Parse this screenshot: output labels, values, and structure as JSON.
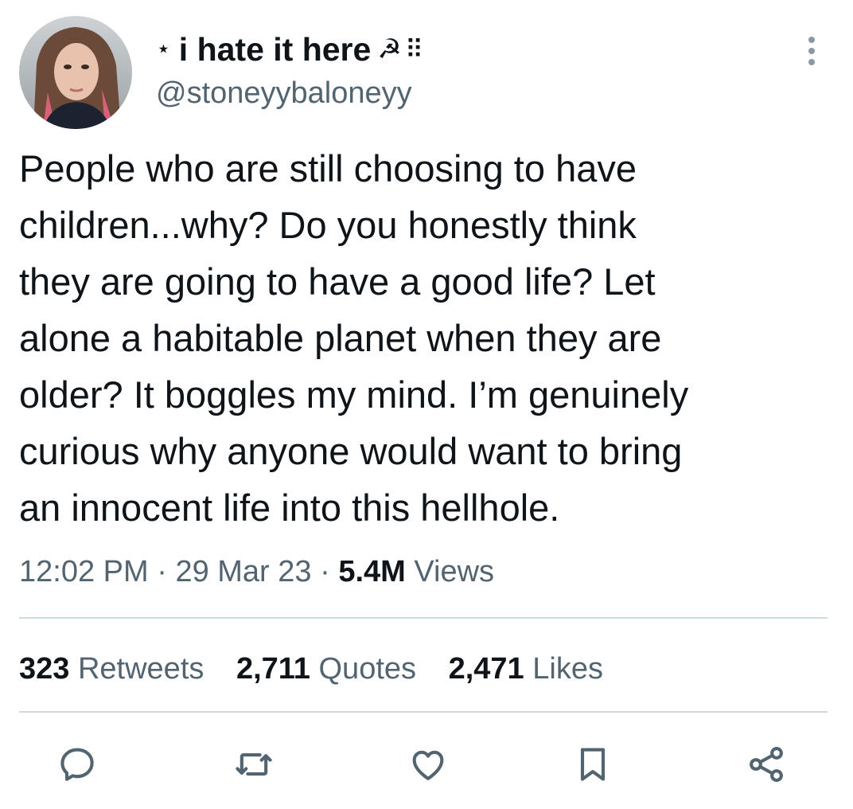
{
  "author": {
    "display_name": "i hate it here",
    "name_prefix_glyph": "⋆",
    "name_suffix_emoji": "☭",
    "name_suffix_glyph": "⠿",
    "handle": "@stoneyybaloneyy",
    "avatar_icon": "profile-photo"
  },
  "tweet": {
    "text_lines": [
      "People who are still choosing to have",
      "children...why? Do you honestly think",
      "they are going to have a good life? Let",
      "alone a habitable planet when they are",
      "older? It boggles my mind. I’m genuinely",
      "curious why anyone would want to bring",
      "an innocent life into this hellhole."
    ]
  },
  "meta": {
    "time": "12:02 PM",
    "separator": "·",
    "date": "29 Mar 23",
    "views_count": "5.4M",
    "views_label": "Views"
  },
  "stats": {
    "retweets_count": "323",
    "retweets_label": "Retweets",
    "quotes_count": "2,711",
    "quotes_label": "Quotes",
    "likes_count": "2,471",
    "likes_label": "Likes"
  },
  "actions": [
    "reply-icon",
    "retweet-icon",
    "like-icon",
    "bookmark-icon",
    "share-icon"
  ],
  "colors": {
    "text": "#0f1419",
    "secondary": "#536471",
    "divider": "#cfd9de",
    "icon": "#536471"
  }
}
